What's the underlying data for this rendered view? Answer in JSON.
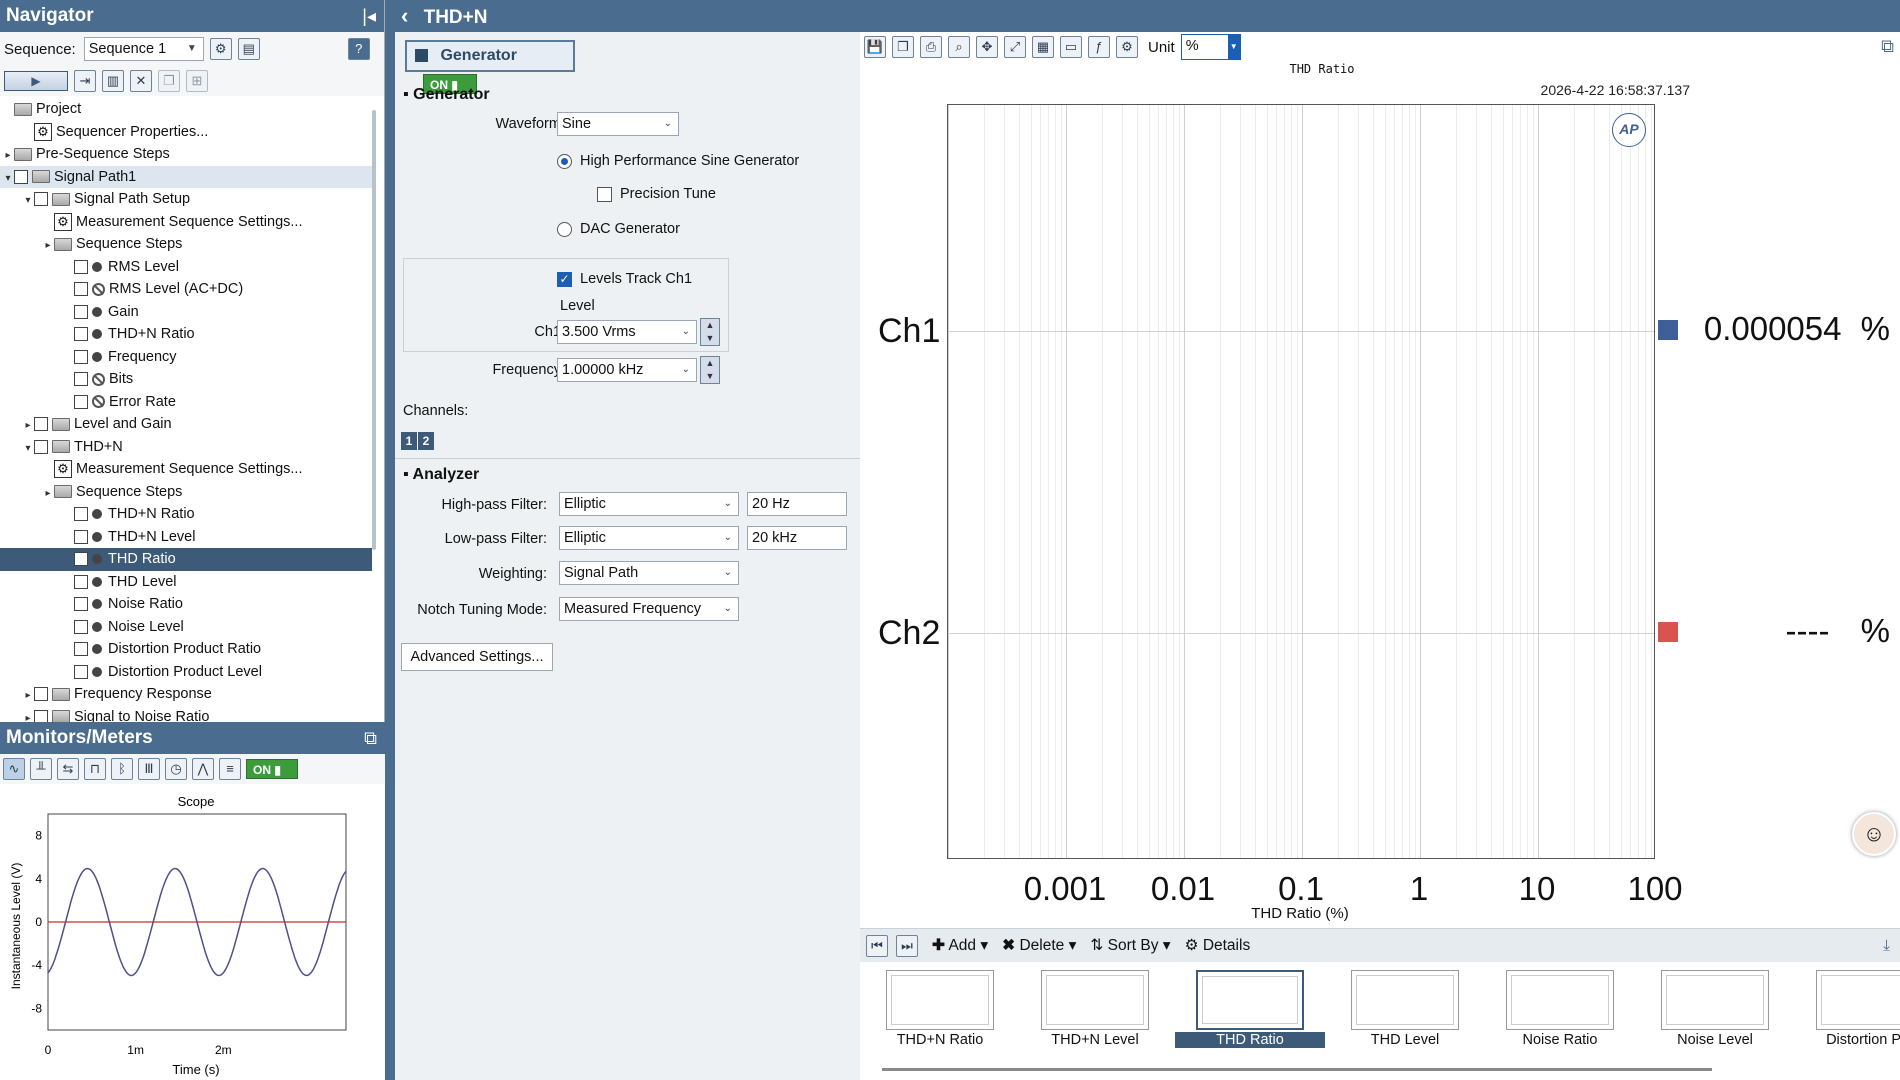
{
  "navigator": {
    "title": "Navigator",
    "pin_glyph": "|◂",
    "sequence_label": "Sequence:",
    "sequence_value": "Sequence 1",
    "tree": [
      {
        "label": "Project",
        "indent": 0,
        "arrow": "",
        "icon": "folder",
        "cb": false
      },
      {
        "label": "Sequencer Properties...",
        "indent": 1,
        "arrow": "",
        "icon": "gear",
        "cb": false
      },
      {
        "label": "Pre-Sequence Steps",
        "indent": 0,
        "arrow": "▸",
        "icon": "folder",
        "cb": false
      },
      {
        "label": "Signal Path1",
        "indent": 0,
        "arrow": "▾",
        "icon": "folder",
        "cb": true,
        "band": true
      },
      {
        "label": "Signal Path Setup",
        "indent": 1,
        "arrow": "▾",
        "icon": "folder",
        "cb": true
      },
      {
        "label": "Measurement Sequence Settings...",
        "indent": 2,
        "arrow": "",
        "icon": "gear",
        "cb": false
      },
      {
        "label": "Sequence Steps",
        "indent": 2,
        "arrow": "▸",
        "icon": "folder",
        "cb": false
      },
      {
        "label": "RMS Level",
        "indent": 3,
        "arrow": "",
        "icon": "dot",
        "cb": true
      },
      {
        "label": "RMS Level (AC+DC)",
        "indent": 3,
        "arrow": "",
        "icon": "nope",
        "cb": true
      },
      {
        "label": "Gain",
        "indent": 3,
        "arrow": "",
        "icon": "dot",
        "cb": true
      },
      {
        "label": "THD+N Ratio",
        "indent": 3,
        "arrow": "",
        "icon": "dot",
        "cb": true
      },
      {
        "label": "Frequency",
        "indent": 3,
        "arrow": "",
        "icon": "dot",
        "cb": true
      },
      {
        "label": "Bits",
        "indent": 3,
        "arrow": "",
        "icon": "nope",
        "cb": true
      },
      {
        "label": "Error Rate",
        "indent": 3,
        "arrow": "",
        "icon": "nope",
        "cb": true
      },
      {
        "label": "Level and Gain",
        "indent": 1,
        "arrow": "▸",
        "icon": "folder",
        "cb": true
      },
      {
        "label": "THD+N",
        "indent": 1,
        "arrow": "▾",
        "icon": "folder",
        "cb": true
      },
      {
        "label": "Measurement Sequence Settings...",
        "indent": 2,
        "arrow": "",
        "icon": "gear",
        "cb": false
      },
      {
        "label": "Sequence Steps",
        "indent": 2,
        "arrow": "▸",
        "icon": "folder",
        "cb": false
      },
      {
        "label": "THD+N Ratio",
        "indent": 3,
        "arrow": "",
        "icon": "dot",
        "cb": true
      },
      {
        "label": "THD+N Level",
        "indent": 3,
        "arrow": "",
        "icon": "dot",
        "cb": true
      },
      {
        "label": "THD Ratio",
        "indent": 3,
        "arrow": "",
        "icon": "dot",
        "cb": true,
        "selected": true
      },
      {
        "label": "THD Level",
        "indent": 3,
        "arrow": "",
        "icon": "dot",
        "cb": true
      },
      {
        "label": "Noise Ratio",
        "indent": 3,
        "arrow": "",
        "icon": "dot",
        "cb": true
      },
      {
        "label": "Noise Level",
        "indent": 3,
        "arrow": "",
        "icon": "dot",
        "cb": true
      },
      {
        "label": "Distortion Product Ratio",
        "indent": 3,
        "arrow": "",
        "icon": "dot",
        "cb": true
      },
      {
        "label": "Distortion Product Level",
        "indent": 3,
        "arrow": "",
        "icon": "dot",
        "cb": true
      },
      {
        "label": "Frequency Response",
        "indent": 1,
        "arrow": "▸",
        "icon": "folder",
        "cb": true
      },
      {
        "label": "Signal to Noise Ratio",
        "indent": 1,
        "arrow": "▸",
        "icon": "folder",
        "cb": true
      }
    ]
  },
  "monitors": {
    "title": "Monitors/Meters",
    "on_label": "ON",
    "scope_title": "Scope",
    "ylabel": "Instantaneous Level (V)",
    "xlabel": "Time (s)",
    "yticks": [
      "8",
      "4",
      "0",
      "-4",
      "-8"
    ],
    "xticks": [
      "0",
      "1m",
      "2m"
    ]
  },
  "step": {
    "title": "THD+N",
    "back_glyph": "‹",
    "generator_button": "Generator",
    "on_label": "ON",
    "generator_section": "Generator",
    "waveform_label": "Waveform:",
    "waveform_value": "Sine",
    "hp_sine": "High Performance Sine Generator",
    "precision_tune": "Precision Tune",
    "dac_generator": "DAC Generator",
    "levels_track": "Levels Track Ch1",
    "level_label": "Level",
    "ch1_label": "Ch1:",
    "ch1_value": "3.500 Vrms",
    "frequency_label": "Frequency:",
    "frequency_value": "1.00000 kHz",
    "channels_label": "Channels:",
    "channel_badges": [
      "1",
      "2"
    ],
    "analyzer_section": "Analyzer",
    "hp_filter_label": "High-pass Filter:",
    "hp_filter_value": "Elliptic",
    "hp_filter_freq": "20 Hz",
    "lp_filter_label": "Low-pass Filter:",
    "lp_filter_value": "Elliptic",
    "lp_filter_freq": "20 kHz",
    "weighting_label": "Weighting:",
    "weighting_value": "Signal Path",
    "notch_label": "Notch Tuning Mode:",
    "notch_value": "Measured Frequency",
    "advanced_button": "Advanced Settings..."
  },
  "graph": {
    "unit_label": "Unit",
    "unit_value": "%",
    "title": "THD Ratio",
    "timestamp": "2026-4-22 16:58:37.137",
    "logo": "AP",
    "xticks": [
      "0.001",
      "0.01",
      "0.1",
      "1",
      "10",
      "100"
    ],
    "xlabel": "THD Ratio (%)",
    "ch1_label": "Ch1",
    "ch2_label": "Ch2",
    "ch1_reading": "0.000054",
    "ch1_unit": "%",
    "ch2_reading": "----",
    "ch2_unit": "%",
    "ch1_color": "#3f5f98",
    "ch2_color": "#d9534f"
  },
  "results": {
    "add_label": "Add",
    "delete_label": "Delete",
    "sort_label": "Sort By",
    "details_label": "Details",
    "thumbnails": [
      "THD+N Ratio",
      "THD+N Level",
      "THD Ratio",
      "THD Level",
      "Noise Ratio",
      "Noise Level",
      "Distortion Pro"
    ],
    "selected_index": 2
  }
}
